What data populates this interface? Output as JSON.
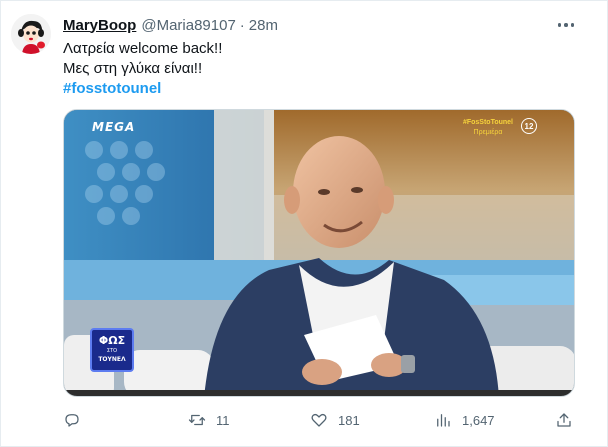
{
  "author": {
    "display_name": "MaryBoop",
    "handle": "@Maria89107",
    "separator": "·",
    "time": "28m",
    "avatar_icon": "betty-boop-avatar"
  },
  "tweet": {
    "lines": [
      "Λατρεία welcome back!!",
      "Μες στη γλύκα είναι!!"
    ],
    "hashtag": "#fosstotounel"
  },
  "media": {
    "channel_logo": "MEGA",
    "tv_hashtag": "#FosStoTounel",
    "tv_premiere": "Πρεμιέρα",
    "rating_badge": "12",
    "show_logo_top": "ΦΩΣ",
    "show_logo_mid": "ΣΤΟ",
    "show_logo_bottom": "ΤΟΥΝΕΛ"
  },
  "actions": {
    "reply": {
      "icon": "reply-icon",
      "count": ""
    },
    "retweet": {
      "icon": "retweet-icon",
      "count": "11"
    },
    "like": {
      "icon": "heart-icon",
      "count": "181"
    },
    "views": {
      "icon": "views-chart-icon",
      "count": "1,647"
    },
    "share": {
      "icon": "share-icon",
      "count": ""
    }
  },
  "colors": {
    "link": "#1d9bf0",
    "secondary_text": "#536471",
    "primary_text": "#0f1419"
  }
}
